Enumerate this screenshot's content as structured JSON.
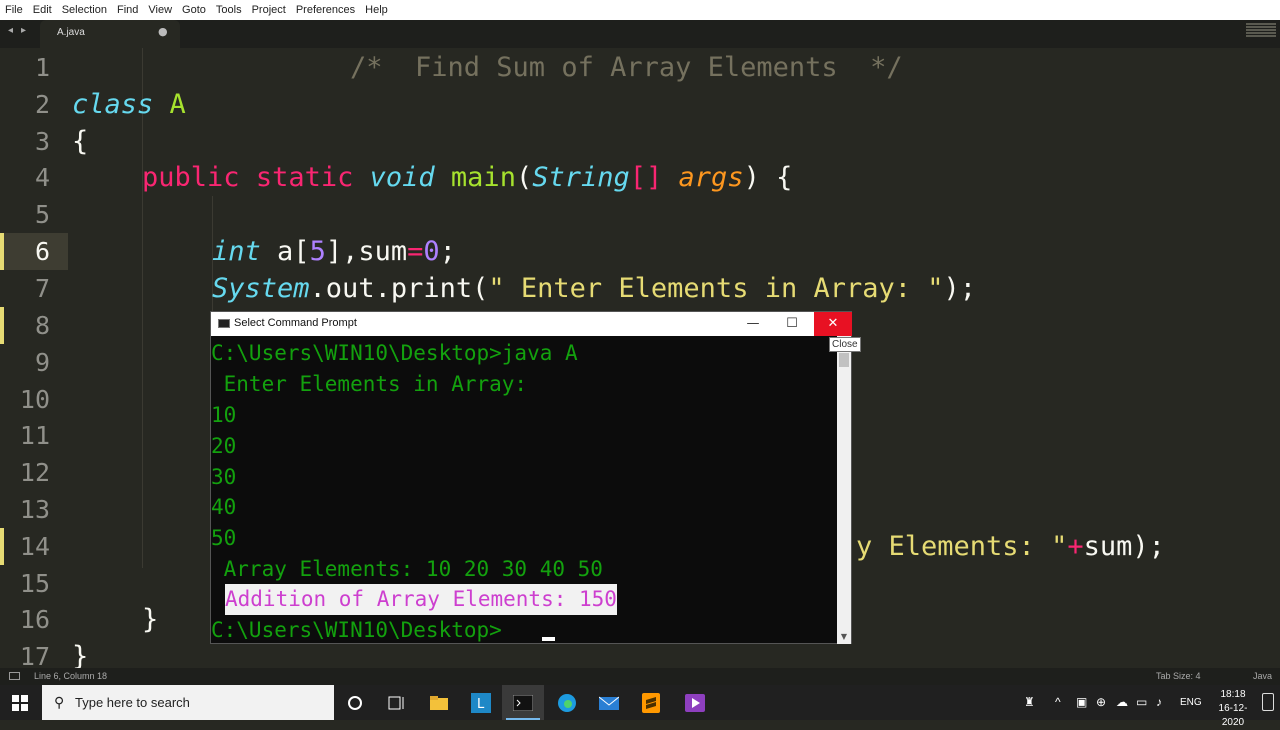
{
  "menu": [
    "File",
    "Edit",
    "Selection",
    "Find",
    "View",
    "Goto",
    "Tools",
    "Project",
    "Preferences",
    "Help"
  ],
  "tabs": {
    "nav_left": "◂",
    "nav_right": "▸",
    "active_file": "A.java",
    "dirty_marker": "●"
  },
  "editor": {
    "line_numbers": [
      "1",
      "2",
      "3",
      "4",
      "5",
      "6",
      "7",
      "8",
      "9",
      "10",
      "11",
      "12",
      "13",
      "14",
      "15",
      "16",
      "17"
    ],
    "code": {
      "l1_comment": "/*  Find Sum of Array Elements  */",
      "l2_kw": "class",
      "l2_name": "A",
      "l3": "{",
      "l4_public": "public",
      "l4_static": "static",
      "l4_void": "void",
      "l4_main": "main",
      "l4_open": "(",
      "l4_type": "String",
      "l4_brackets": "[]",
      "l4_args": "args",
      "l4_close": ") {",
      "l6_int": "int",
      "l6_a": " a[",
      "l6_5": "5",
      "l6_mid": "],sum",
      "l6_eq": "=",
      "l6_0": "0",
      "l6_end": ";",
      "l7_system": "System",
      "l7_mid": ".out.print(",
      "l7_str": "\" Enter Elements in Array: \"",
      "l7_end": ");",
      "l14_str": "y Elements: \"",
      "l14_plus": "+",
      "l14_end": "sum);",
      "l16": "}",
      "l17": "}"
    }
  },
  "cmd": {
    "title": "Select Command Prompt",
    "btn_min": "—",
    "btn_max": "☐",
    "btn_close": "✕",
    "tooltip": "Close",
    "lines": [
      "C:\\Users\\WIN10\\Desktop>java A",
      " Enter Elements in Array:",
      "10",
      "20",
      "30",
      "40",
      "50",
      " Array Elements: 10 20 30 40 50",
      "Addition of Array Elements: 150",
      "C:\\Users\\WIN10\\Desktop>"
    ],
    "scroll_up": "▲",
    "scroll_down": "▼"
  },
  "status": {
    "position": "Line 6, Column 18",
    "tab_size": "Tab Size: 4",
    "syntax": "Java"
  },
  "taskbar": {
    "search_placeholder": "Type here to search",
    "search_glyph": "⚲",
    "tray_lang": "ENG",
    "time": "18:18",
    "date": "16-12-2020"
  },
  "colors": {
    "editor_bg": "#272822",
    "keyword_pink": "#f92672",
    "keyword_cyan": "#66d9ef",
    "function_green": "#a6e22e",
    "string_yellow": "#e6db74",
    "number_purple": "#ae81ff",
    "cmd_text_green": "#13a10e",
    "cmd_highlight_magenta": "#cd3fcf",
    "close_red": "#e81123"
  }
}
